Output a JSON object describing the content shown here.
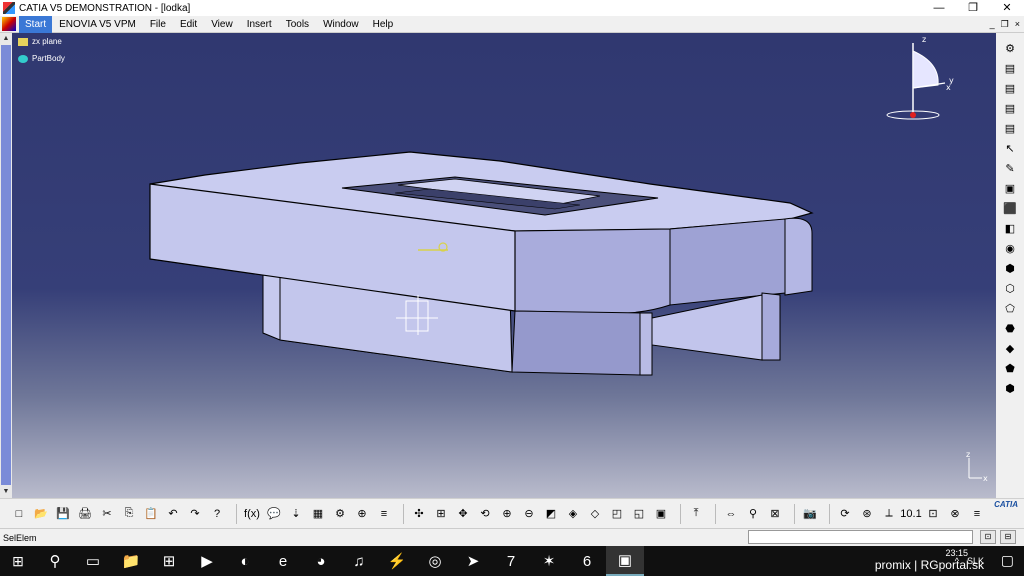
{
  "window": {
    "title": "CATIA V5 DEMONSTRATION - [lodka]",
    "controls": [
      "—",
      "❐",
      "✕"
    ]
  },
  "menubar": {
    "items": [
      "Start",
      "ENOVIA V5 VPM",
      "File",
      "Edit",
      "View",
      "Insert",
      "Tools",
      "Window",
      "Help"
    ],
    "mdi_controls": [
      "_",
      "❐",
      "×"
    ]
  },
  "tree": {
    "items": [
      "zx plane",
      "PartBody"
    ]
  },
  "compass": {
    "z": "z",
    "x": "x",
    "y": "y"
  },
  "axis_mini": {
    "z": "z",
    "x": "x"
  },
  "right_toolbar": [
    "⚙",
    "▤",
    "▤",
    "▤",
    "▤",
    "↖",
    "✎",
    "▣",
    "⬛",
    "◧",
    "◉",
    "⬢",
    "⬡",
    "⬠",
    "⬣",
    "◆",
    "⬟",
    "⬢"
  ],
  "bottom_toolbar_groups": [
    [
      "□",
      "📂",
      "💾",
      "🖨",
      "✂",
      "⎘",
      "📋",
      "↶",
      "↷",
      "?"
    ],
    [
      "f(x)",
      "💬",
      "⇣",
      "▦",
      "⚙",
      "⊕",
      "≡"
    ],
    [
      "✣",
      "⊞",
      "✥",
      "⟲",
      "⊕",
      "⊖",
      "◩",
      "◈",
      "◇",
      "◰",
      "◱",
      "▣"
    ],
    [
      "⤒"
    ],
    [
      "⇔",
      "⚲",
      "⊠"
    ],
    [
      "📷"
    ],
    [
      "⟳",
      "⊛",
      "⟂",
      "10.1",
      "⊡",
      "⊗",
      "≡"
    ]
  ],
  "catia_logo": "CATIA",
  "status": {
    "text": "SelElem",
    "buttons": [
      "⊡",
      "⊟"
    ]
  },
  "taskbar": {
    "icons": [
      "⚲",
      "▭",
      "📁",
      "⊞",
      "▶",
      "◐",
      "e",
      "◕",
      "♫",
      "⚡",
      "◎",
      "➤",
      "7",
      "✶",
      "6",
      "▣"
    ]
  },
  "clock": {
    "time": "23:15"
  },
  "tray": {
    "lang": "SLK",
    "user": "promix"
  },
  "watermark": "promix | RGportal.sk",
  "colors": {
    "part": "#b8bce6",
    "viewport_top": "#303870",
    "accent": "#3a78d6"
  }
}
